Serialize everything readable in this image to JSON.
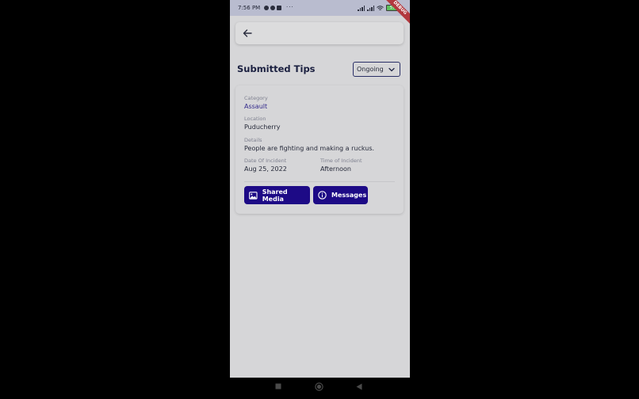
{
  "status_bar": {
    "time": "7:56 PM",
    "battery": "57"
  },
  "debug_banner": "DEBUG",
  "header": {
    "title": "Submitted Tips"
  },
  "filter": {
    "selected": "Ongoing"
  },
  "tip": {
    "category_label": "Category",
    "category_value": "Assault",
    "location_label": "Location",
    "location_value": "Puducherry",
    "details_label": "Details",
    "details_value": "People are fighting and making a ruckus.",
    "date_label": "Date Of Incident",
    "date_value": "Aug 25, 2022",
    "time_label": "Time of Incident",
    "time_value": "Afternoon"
  },
  "actions": {
    "shared_media": "Shared Media",
    "messages": "Messages"
  },
  "colors": {
    "accent": "#1d0a86",
    "overlay": "#d6d6d8",
    "debug": "#b2383e"
  },
  "icons": [
    "arrow-back-icon",
    "chevron-down-icon",
    "image-icon",
    "info-icon",
    "nav-recents-icon",
    "nav-home-icon",
    "nav-back-icon"
  ]
}
